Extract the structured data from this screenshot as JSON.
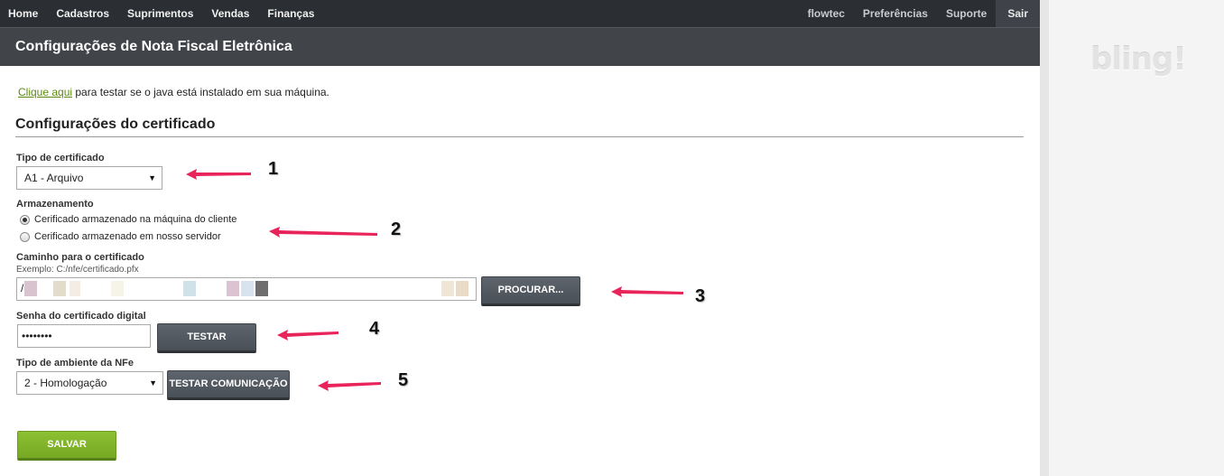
{
  "nav": {
    "left": [
      "Home",
      "Cadastros",
      "Suprimentos",
      "Vendas",
      "Finanças"
    ],
    "right": [
      "flowtec",
      "Preferências",
      "Suporte"
    ],
    "exit": "Sair"
  },
  "header": {
    "title": "Configurações de Nota Fiscal Eletrônica"
  },
  "brand": {
    "logo": "bling!"
  },
  "java": {
    "link": "Clique aqui",
    "text": " para testar se o java está instalado em sua máquina."
  },
  "section": {
    "title": "Configurações do certificado"
  },
  "form": {
    "cert_type_label": "Tipo de certificado",
    "cert_type_value": "A1 - Arquivo",
    "storage_label": "Armazenamento",
    "storage_options": [
      {
        "label": "Cerificado armazenado na máquina do cliente",
        "checked": true
      },
      {
        "label": "Cerificado armazenado em nosso servidor",
        "checked": false
      }
    ],
    "path_label": "Caminho para o certificado",
    "path_hint": "Exemplo: C:/nfe/certificado.pfx",
    "path_value": "/",
    "browse_button": "PROCURAR...",
    "password_label": "Senha do certificado digital",
    "password_value": "••••••••",
    "test_button": "TESTAR",
    "env_label": "Tipo de ambiente da NFe",
    "env_value": "2 - Homologação",
    "test_comm_button": "TESTAR COMUNICAÇÃO",
    "save_button": "SALVAR"
  },
  "annotations": [
    "1",
    "2",
    "3",
    "4",
    "5"
  ],
  "colors": {
    "arrow": "#e8245a",
    "nav_bg": "#2b2e33",
    "header_bg": "#414549",
    "save_green": "#80b22b",
    "link_green": "#5b8a12"
  }
}
